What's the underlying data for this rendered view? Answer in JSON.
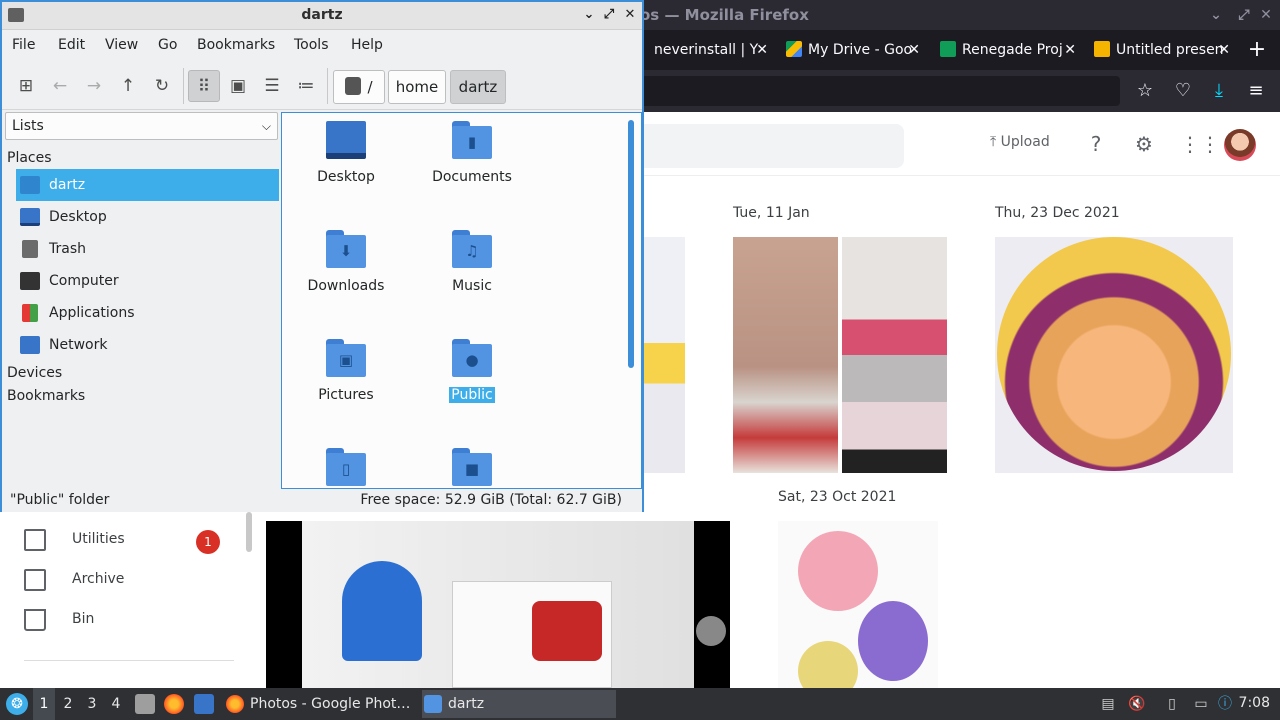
{
  "firefox": {
    "title": "os — Mozilla Firefox",
    "tabs": [
      {
        "label": "neverinstall | Y",
        "color": "#1c1b22"
      },
      {
        "label": "My Drive - Goo",
        "color": "#fbbc04"
      },
      {
        "label": "Renegade Proj",
        "color": "#0f9d58"
      },
      {
        "label": "Untitled presen",
        "color": "#f4b400"
      }
    ],
    "new_tab": "+",
    "icons": {
      "bookmark": "bookmark-star-icon",
      "pocket": "pocket-icon",
      "downloads": "download-icon",
      "menu": "hamburger-menu-icon"
    }
  },
  "photos": {
    "upload_label": "Upload",
    "dates": [
      "Tue, 11 Jan",
      "Thu, 23 Dec 2021",
      "Sat, 23 Oct 2021"
    ],
    "sidebar": [
      {
        "label": "Utilities",
        "badge": "1"
      },
      {
        "label": "Archive"
      },
      {
        "label": "Bin"
      }
    ]
  },
  "filemanager": {
    "title": "dartz",
    "menu": [
      "File",
      "Edit",
      "View",
      "Go",
      "Bookmarks",
      "Tools",
      "Help"
    ],
    "breadcrumbs": [
      "/",
      "home",
      "dartz"
    ],
    "side_select": "Lists",
    "headings": {
      "places": "Places",
      "devices": "Devices",
      "bookmarks": "Bookmarks"
    },
    "places": [
      {
        "label": "dartz",
        "selected": true
      },
      {
        "label": "Desktop"
      },
      {
        "label": "Trash"
      },
      {
        "label": "Computer"
      },
      {
        "label": "Applications"
      },
      {
        "label": "Network"
      }
    ],
    "items": [
      {
        "name": "Desktop",
        "glyph": ""
      },
      {
        "name": "Documents",
        "glyph": "▮"
      },
      {
        "name": "Downloads",
        "glyph": "⬇"
      },
      {
        "name": "Music",
        "glyph": "♫"
      },
      {
        "name": "Pictures",
        "glyph": "▣"
      },
      {
        "name": "Public",
        "glyph": "●",
        "selected": true
      },
      {
        "name": "",
        "glyph": "▯"
      },
      {
        "name": "",
        "glyph": "■"
      }
    ],
    "status_left": "\"Public\" folder",
    "status_right": "Free space: 52.9 GiB (Total: 62.7 GiB)"
  },
  "taskbar": {
    "workspaces": [
      "1",
      "2",
      "3",
      "4"
    ],
    "current_workspace": "1",
    "tasks": [
      {
        "label": "Photos - Google Phot…"
      },
      {
        "label": "dartz",
        "active": true
      }
    ],
    "clock": "7:08"
  },
  "colors": {
    "accent": "#3daee9",
    "folder": "#5294e2",
    "badge": "#d93025"
  }
}
